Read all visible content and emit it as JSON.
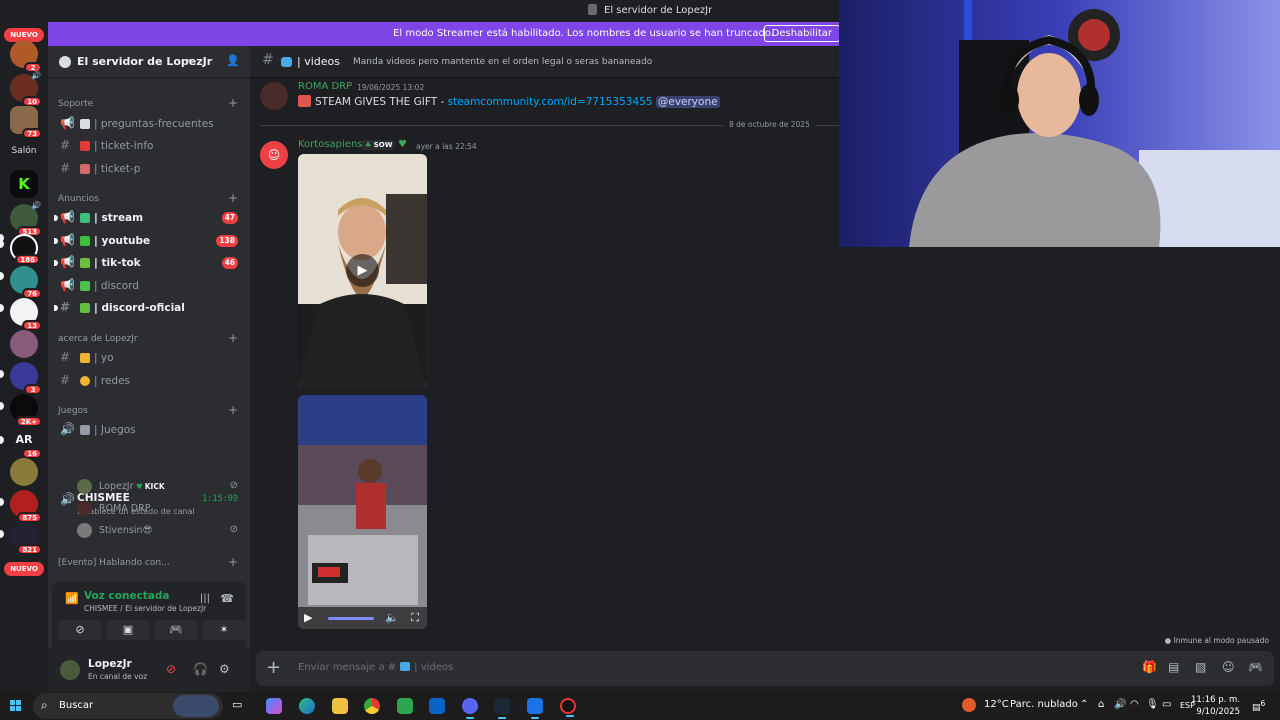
{
  "window": {
    "title": "El servidor de LopezJr"
  },
  "banner": {
    "message": "El modo Streamer está habilitado. Los nombres de usuario se han truncado.",
    "button": "Deshabilitar"
  },
  "rail": {
    "nuevo_top": "NUEVO",
    "nuevo_bottom": "NUEVO",
    "salon_label": "Salón",
    "badges": [
      "2",
      "10",
      "73",
      "513",
      "186",
      "76",
      "13",
      "3",
      "2K+",
      "16",
      "875",
      "821"
    ],
    "ar_label": "AR"
  },
  "server": {
    "name": "El servidor de LopezJr",
    "categories": {
      "soporte": "Soporte",
      "anuncios": "Anuncios",
      "acerca": "acerca de LopezJr",
      "juegos": "Juegos",
      "evento": "[Evento] Hablando con..."
    },
    "channels": {
      "preguntas": "| preguntas-frecuentes",
      "ticket_info": "| ticket-info",
      "ticket_p": "| ticket-p",
      "stream": "| stream",
      "stream_count": "47",
      "youtube": "| youtube",
      "youtube_count": "138",
      "tiktok": "| tik-tok",
      "tiktok_count": "46",
      "discord": "| discord",
      "discord_oficial": "| discord-oficial",
      "yo": "| yo",
      "redes": "| redes",
      "juegos": "| Juegos"
    },
    "voice": {
      "name": "CHISMEE",
      "time": "1:15:09",
      "status": "Establece un estado de canal",
      "users": [
        {
          "name": "LopezJr",
          "tag": "KICK"
        },
        {
          "name": "ROMA DRP",
          "tag": ""
        },
        {
          "name": "Stivensin😎",
          "tag": ""
        }
      ]
    }
  },
  "voice_panel": {
    "title": "Voz conectada",
    "subtitle": "CHISMEE / El servidor de LopezJr"
  },
  "user": {
    "name": "LopezJr",
    "status": "En canal de voz"
  },
  "channel_header": {
    "name": "| videos",
    "topic": "Manda videos pero mantente en el orden legal o seras bananeado"
  },
  "messages": [
    {
      "author": "ROMA DRP",
      "timestamp": "19/06/2025 13:02",
      "text": "STEAM GIVES THE GIFT - ",
      "link": "steamcommunity.com/id=7715353455",
      "mention": "@everyone"
    },
    {
      "author": "Kortosapiens",
      "badge": "SOW",
      "timestamp": "ayer a las 22:54"
    }
  ],
  "date_divider": "8 de octubre de 2025",
  "immune_text": "Inmune al modo pausado",
  "composer": {
    "placeholder": "Enviar mensaje a #",
    "channel": "| videos"
  },
  "taskbar": {
    "search": "Buscar",
    "weather": "12°C",
    "weather_desc": "Parc. nublado",
    "lang": "ESP",
    "time": "11:16 p. m.",
    "date": "9/10/2025",
    "notif": "6"
  },
  "colors": {
    "accent": "#7f45e6",
    "online": "#23a55a",
    "badge": "#f23f43",
    "link": "#00a8fc"
  }
}
